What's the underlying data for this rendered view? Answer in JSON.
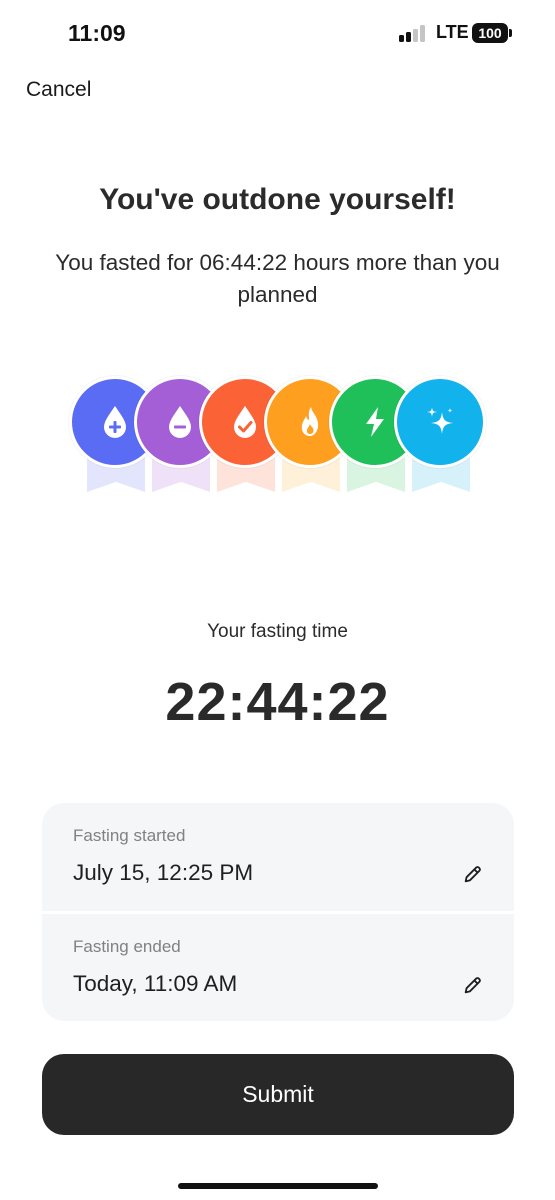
{
  "status_bar": {
    "time": "11:09",
    "network": "LTE",
    "battery": "100"
  },
  "nav": {
    "cancel_label": "Cancel"
  },
  "hero": {
    "title": "You've outdone yourself!",
    "subtitle": "You fasted for 06:44:22 hours more than you planned"
  },
  "badges": [
    {
      "name": "drop-plus-icon",
      "color": "#5b6cf4",
      "ribbon": "#e3e5fd"
    },
    {
      "name": "drop-minus-icon",
      "color": "#a45ed6",
      "ribbon": "#efe2f8"
    },
    {
      "name": "drop-check-icon",
      "color": "#fb6235",
      "ribbon": "#fde3da"
    },
    {
      "name": "flame-icon",
      "color": "#ff9f1f",
      "ribbon": "#fff0d9"
    },
    {
      "name": "lightning-icon",
      "color": "#1fbf5a",
      "ribbon": "#d9f4e1"
    },
    {
      "name": "sparkles-icon",
      "color": "#12b2ec",
      "ribbon": "#d7f1fb"
    }
  ],
  "fasting": {
    "label": "Your fasting time",
    "time": "22:44:22"
  },
  "details": {
    "started_label": "Fasting started",
    "started_value": "July 15, 12:25 PM",
    "ended_label": "Fasting ended",
    "ended_value": "Today, 11:09 AM"
  },
  "actions": {
    "submit_label": "Submit"
  }
}
